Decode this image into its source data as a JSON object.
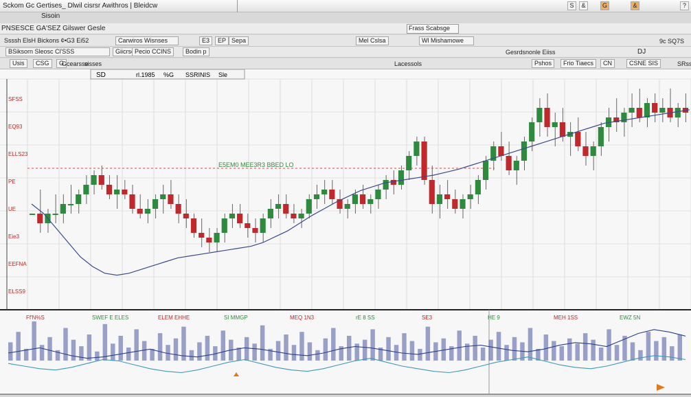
{
  "window": {
    "title": "Sckom  Gc  Gertises_ Dlwil cisrsr   Awithros | Bleidcw",
    "tab_label": "Sisoin",
    "controls": [
      "S",
      "&",
      "G",
      "&",
      "?"
    ]
  },
  "menubar": {
    "left_text": "PNSESCE  GA'SEZ  Gilswer  Gesle",
    "tab_label": "Frass Scabsge"
  },
  "toolbar1": {
    "left_text": "Ssssh ElsH Bickons  ¢•G3 Ei52",
    "items": [
      "Carwiros  Wisnses",
      "E3",
      "EP",
      "Sepa",
      "Mel Cslsa"
    ],
    "right_label": "Wl Mishamowe",
    "far_right": "9c SQ7S"
  },
  "toolbar2": {
    "items": [
      "BSiksorn Sleosc  Cl'SSS",
      "Giicrse",
      "Pecio CCINS",
      "Bodin p",
      "Gesrdsnonle Eiiss"
    ],
    "right_mark": "DJ"
  },
  "toolbar3": {
    "items": [
      "Usis",
      "CSG",
      "G",
      "Gcearsse",
      "sisses"
    ],
    "center_label": "Lacessols",
    "right_items": [
      "Pshos",
      "Frio Tiaecs",
      "CN",
      "CSNE SIS",
      "SRss"
    ]
  },
  "chart_header": {
    "symbol": "SD",
    "price_label": "rl.1985",
    "items": [
      "%G",
      "SSRINIS",
      "Sle"
    ]
  },
  "colors": {
    "up": "#2e8b3e",
    "down": "#c0282b",
    "line": "#3a4a8c",
    "ref": "#d94a4a",
    "volume": "#4d5aa0",
    "osc_blue": "#2a3f8c",
    "osc_cyan": "#3a9ab8",
    "marker": "#e07a1a"
  },
  "chart_data": [
    {
      "type": "candlestick",
      "title": "",
      "ylabel": "",
      "y_tick_labels": [
        "SFSS",
        "EQ93",
        "ELLS23",
        "PE",
        "UE",
        "Eie3",
        "EEFNA",
        "ELSS9"
      ],
      "grid": true,
      "reference_line_label": "E5EM0 MEE3R3 BBED LO",
      "candles": [
        [
          300,
          300,
          300,
          300
        ],
        [
          300,
          325,
          280,
          290
        ],
        [
          290,
          305,
          280,
          300
        ],
        [
          300,
          320,
          290,
          300
        ],
        [
          300,
          320,
          290,
          310
        ],
        [
          310,
          330,
          300,
          310
        ],
        [
          310,
          325,
          300,
          320
        ],
        [
          320,
          340,
          310,
          330
        ],
        [
          330,
          345,
          320,
          340
        ],
        [
          340,
          350,
          325,
          330
        ],
        [
          330,
          340,
          315,
          320
        ],
        [
          320,
          340,
          305,
          325
        ],
        [
          325,
          335,
          315,
          320
        ],
        [
          320,
          330,
          300,
          305
        ],
        [
          305,
          320,
          295,
          300
        ],
        [
          300,
          315,
          290,
          305
        ],
        [
          305,
          320,
          295,
          315
        ],
        [
          315,
          330,
          300,
          320
        ],
        [
          320,
          335,
          305,
          310
        ],
        [
          310,
          320,
          290,
          300
        ],
        [
          300,
          315,
          285,
          295
        ],
        [
          295,
          300,
          275,
          280
        ],
        [
          280,
          295,
          265,
          275
        ],
        [
          275,
          285,
          260,
          270
        ],
        [
          270,
          285,
          260,
          280
        ],
        [
          280,
          300,
          270,
          295
        ],
        [
          295,
          310,
          285,
          300
        ],
        [
          300,
          310,
          285,
          290
        ],
        [
          290,
          300,
          275,
          285
        ],
        [
          285,
          295,
          270,
          280
        ],
        [
          280,
          300,
          270,
          295
        ],
        [
          295,
          315,
          285,
          305
        ],
        [
          305,
          320,
          295,
          310
        ],
        [
          310,
          320,
          295,
          300
        ],
        [
          300,
          310,
          290,
          295
        ],
        [
          295,
          305,
          285,
          300
        ],
        [
          300,
          320,
          295,
          315
        ],
        [
          315,
          330,
          305,
          320
        ],
        [
          320,
          335,
          310,
          325
        ],
        [
          325,
          335,
          310,
          315
        ],
        [
          315,
          325,
          300,
          305
        ],
        [
          305,
          315,
          295,
          310
        ],
        [
          310,
          325,
          300,
          320
        ],
        [
          320,
          330,
          305,
          310
        ],
        [
          310,
          320,
          300,
          315
        ],
        [
          315,
          330,
          305,
          325
        ],
        [
          325,
          340,
          315,
          335
        ],
        [
          335,
          345,
          320,
          330
        ],
        [
          330,
          350,
          325,
          345
        ],
        [
          345,
          365,
          335,
          360
        ],
        [
          360,
          380,
          350,
          375
        ],
        [
          375,
          380,
          330,
          335
        ],
        [
          335,
          350,
          300,
          310
        ],
        [
          310,
          330,
          295,
          320
        ],
        [
          320,
          335,
          305,
          315
        ],
        [
          315,
          325,
          300,
          305
        ],
        [
          305,
          320,
          295,
          315
        ],
        [
          315,
          330,
          305,
          320
        ],
        [
          320,
          340,
          310,
          335
        ],
        [
          335,
          360,
          325,
          355
        ],
        [
          355,
          375,
          345,
          370
        ],
        [
          370,
          385,
          355,
          360
        ],
        [
          360,
          375,
          340,
          345
        ],
        [
          345,
          360,
          330,
          355
        ],
        [
          355,
          380,
          345,
          375
        ],
        [
          375,
          400,
          365,
          395
        ],
        [
          395,
          420,
          380,
          410
        ],
        [
          410,
          425,
          380,
          390
        ],
        [
          390,
          405,
          370,
          395
        ],
        [
          395,
          410,
          375,
          380
        ],
        [
          380,
          395,
          360,
          385
        ],
        [
          385,
          400,
          365,
          370
        ],
        [
          370,
          385,
          350,
          360
        ],
        [
          360,
          375,
          345,
          370
        ],
        [
          370,
          395,
          360,
          390
        ],
        [
          390,
          410,
          375,
          400
        ],
        [
          400,
          420,
          385,
          395
        ],
        [
          395,
          410,
          380,
          405
        ],
        [
          405,
          425,
          390,
          410
        ],
        [
          410,
          430,
          395,
          400
        ],
        [
          400,
          420,
          390,
          415
        ],
        [
          415,
          425,
          395,
          405
        ],
        [
          405,
          420,
          395,
          410
        ],
        [
          410,
          430,
          395,
          400
        ],
        [
          400,
          415,
          390,
          410
        ],
        [
          410,
          425,
          395,
          405
        ]
      ],
      "overlay_line": [
        310,
        300,
        285,
        270,
        255,
        245,
        238,
        236,
        238,
        242,
        246,
        250,
        254,
        256,
        258,
        260,
        262,
        264,
        266,
        270,
        276,
        282,
        290,
        298,
        305,
        312,
        318,
        324,
        328,
        332,
        334,
        336,
        338,
        340,
        343,
        346,
        350,
        354,
        358,
        362,
        366,
        370,
        374,
        378,
        382,
        386,
        390,
        394,
        396,
        398,
        400,
        402,
        404,
        406,
        408
      ],
      "ylim": [
        200,
        440
      ]
    },
    {
      "type": "bar",
      "title": "",
      "labels": [
        "Ff'N%S",
        "SWEF E ELES",
        "ELEM EHHE",
        "SI MMGP",
        "MEQ 1N3",
        "rE 8 SS",
        "SE3",
        "HE 9",
        "MEH 1SS",
        "EWZ 5N"
      ],
      "volume": [
        14,
        22,
        9,
        30,
        12,
        18,
        8,
        25,
        16,
        11,
        20,
        7,
        28,
        13,
        19,
        10,
        24,
        15,
        9,
        21,
        12,
        17,
        26,
        8,
        14,
        19,
        11,
        23,
        16,
        10,
        18,
        13,
        27,
        9,
        15,
        20,
        12,
        22,
        14,
        8,
        17,
        25,
        11,
        19,
        13,
        16,
        24,
        10,
        18,
        12,
        21,
        15,
        9,
        26,
        14,
        17,
        11,
        23,
        13,
        19,
        10,
        16,
        22,
        12,
        18,
        14,
        25,
        9,
        20,
        15,
        11,
        17,
        13,
        21,
        16,
        10,
        24,
        12,
        19,
        14,
        8,
        22,
        15,
        18,
        11,
        20
      ],
      "line_a": [
        30,
        32,
        34,
        31,
        28,
        26,
        27,
        29,
        31,
        33,
        30,
        28,
        27,
        29,
        32,
        34,
        33,
        31,
        29,
        28,
        30,
        33,
        35,
        34,
        32,
        30,
        29,
        31,
        33,
        35,
        36,
        34,
        32,
        31,
        33,
        36,
        38,
        37,
        35,
        40,
        45,
        48,
        46,
        43
      ],
      "line_b": [
        22,
        20,
        18,
        17,
        19,
        22,
        25,
        24,
        21,
        18,
        16,
        15,
        17,
        20,
        23,
        25,
        22,
        19,
        17,
        16,
        18,
        21,
        24,
        26,
        23,
        20,
        18,
        16,
        15,
        17,
        20,
        23,
        25,
        27,
        24,
        21,
        19,
        18,
        20,
        23,
        26,
        28,
        27,
        25
      ],
      "ylim": [
        0,
        60
      ]
    }
  ]
}
